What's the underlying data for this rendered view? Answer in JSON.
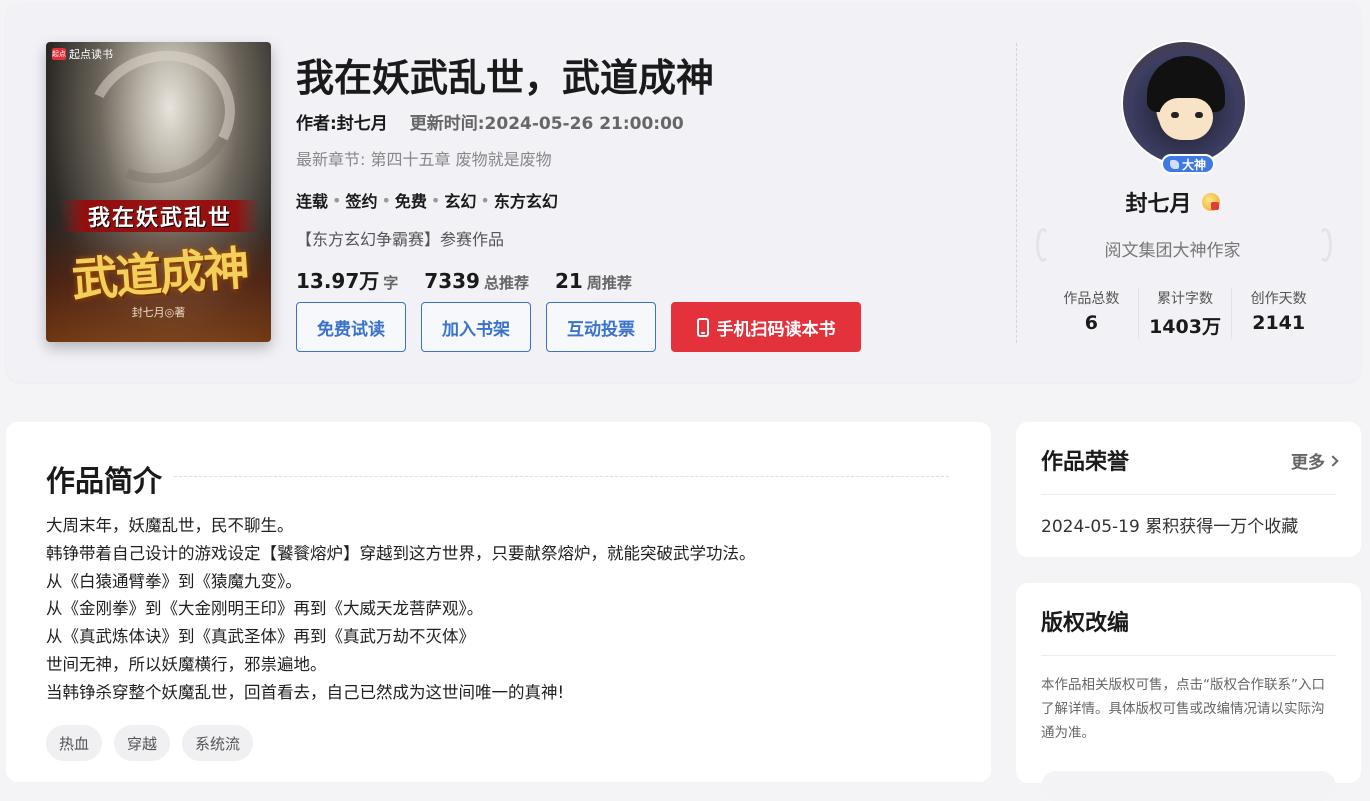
{
  "book": {
    "title": "我在妖武乱世，武道成神",
    "author_label": "作者:封七月",
    "update_label": "更新时间:2024-05-26 21:00:00",
    "latest_chapter": "最新章节: 第四十五章 废物就是废物",
    "tags": [
      "连载",
      "签约",
      "免费",
      "玄幻",
      "东方玄幻"
    ],
    "contest": "【东方玄幻争霸赛】参赛作品",
    "stats": [
      {
        "value": "13.97万",
        "unit": "字"
      },
      {
        "value": "7339",
        "unit": "总推荐"
      },
      {
        "value": "21",
        "unit": "周推荐"
      }
    ],
    "cover": {
      "brand": "起点读书",
      "brand_logo": "起点",
      "line1": "我在妖武乱世",
      "line2": "武道成神",
      "author_mark": "封七月◎著"
    }
  },
  "actions": {
    "free_read": "免费试读",
    "add_shelf": "加入书架",
    "vote": "互动投票",
    "scan_read": "手机扫码读本书"
  },
  "author": {
    "name": "封七月",
    "badge": "大神",
    "title": "阅文集团大神作家",
    "stats": [
      {
        "label": "作品总数",
        "value": "6"
      },
      {
        "label": "累计字数",
        "value": "1403万"
      },
      {
        "label": "创作天数",
        "value": "2141"
      }
    ]
  },
  "intro": {
    "title": "作品简介",
    "paragraphs": [
      "大周末年，妖魔乱世，民不聊生。",
      "韩铮带着自己设计的游戏设定【饕餮熔炉】穿越到这方世界，只要献祭熔炉，就能突破武学功法。",
      "从《白猿通臂拳》到《猿魔九变》。",
      "从《金刚拳》到《大金刚明王印》再到《大威天龙菩萨观》。",
      "从《真武炼体诀》到《真武圣体》再到《真武万劫不灭体》",
      "世间无神，所以妖魔横行，邪祟遍地。",
      "当韩铮杀穿整个妖魔乱世，回首看去，自己已然成为这世间唯一的真神!"
    ],
    "tags": [
      "热血",
      "穿越",
      "系统流"
    ]
  },
  "honors": {
    "title": "作品荣誉",
    "more": "更多",
    "items": [
      "2024-05-19 累积获得一万个收藏"
    ]
  },
  "copyright": {
    "title": "版权改编",
    "text": "本作品相关版权可售，点击“版权合作联系”入口了解详情。具体版权可售或改编情况请以实际沟通为准。"
  },
  "colors": {
    "accent": "#3a73c9",
    "primary_button": "#e4323c",
    "badge": "#3f79e6"
  }
}
